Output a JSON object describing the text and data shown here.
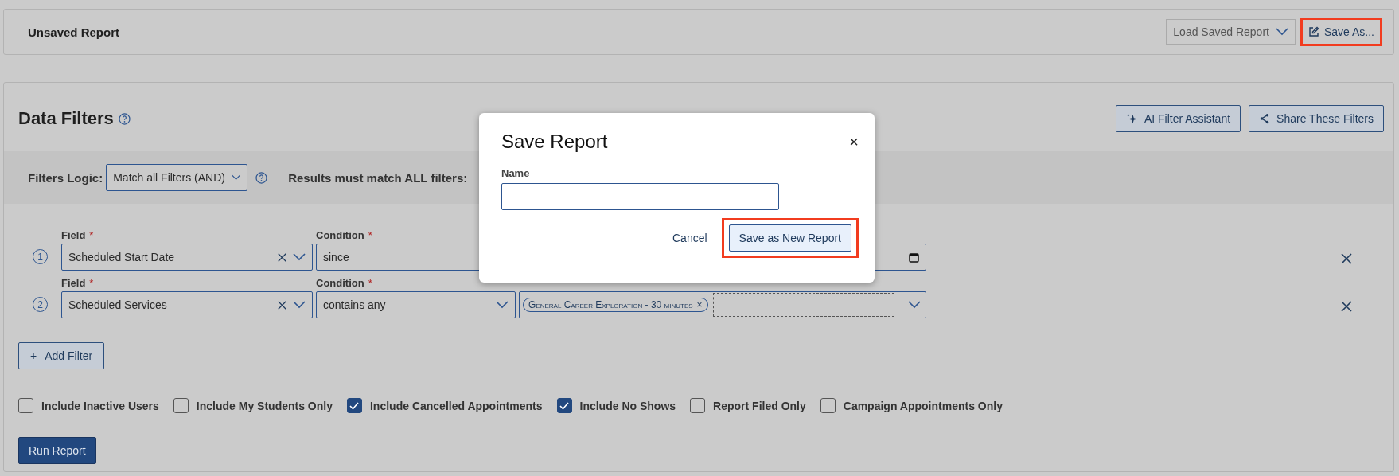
{
  "header": {
    "title": "Unsaved Report",
    "load_select": {
      "value": "Load Saved Report"
    },
    "save_as_button": {
      "label": "Save As...",
      "highlighted": true
    }
  },
  "filters_panel": {
    "title": "Data Filters",
    "buttons": [
      {
        "label": "AI Filter Assistant",
        "kind": "sparkle"
      },
      {
        "label": "Share These Filters",
        "kind": "share"
      }
    ],
    "logic": {
      "label": "Filters Logic:",
      "value": "Match all Filters (AND)",
      "note": "Results must match ALL filters:"
    },
    "filters": [
      {
        "number": "1",
        "field": {
          "label": "Field",
          "mark": "*",
          "value": "Scheduled Start Date"
        },
        "condition": {
          "label": "Condition",
          "mark": "*",
          "value": "since"
        },
        "value": {
          "kind": "date"
        }
      },
      {
        "number": "2",
        "field": {
          "label": "Field",
          "mark": "*",
          "value": "Scheduled Services"
        },
        "condition": {
          "label": "Condition",
          "mark": "*",
          "value": "contains any"
        },
        "value": {
          "kind": "tags",
          "tags": [
            {
              "label": "General Career Exploration - 30 minutes",
              "remove": "×"
            }
          ]
        }
      }
    ],
    "add_filter": {
      "icon": "+",
      "label": "Add Filter"
    },
    "options": [
      {
        "label": "Include Inactive Users",
        "checked": false
      },
      {
        "label": "Include My Students Only",
        "checked": false
      },
      {
        "label": "Include Cancelled Appointments",
        "checked": true
      },
      {
        "label": "Include No Shows",
        "checked": true
      },
      {
        "label": "Report Filed Only",
        "checked": false
      },
      {
        "label": "Campaign Appointments Only",
        "checked": false
      }
    ],
    "run_button": "Run Report"
  },
  "dialog": {
    "title": "Save Report",
    "close": "×",
    "name_label": "Name",
    "cancel": "Cancel",
    "save": {
      "label": "Save as New Report",
      "highlighted": true
    }
  }
}
